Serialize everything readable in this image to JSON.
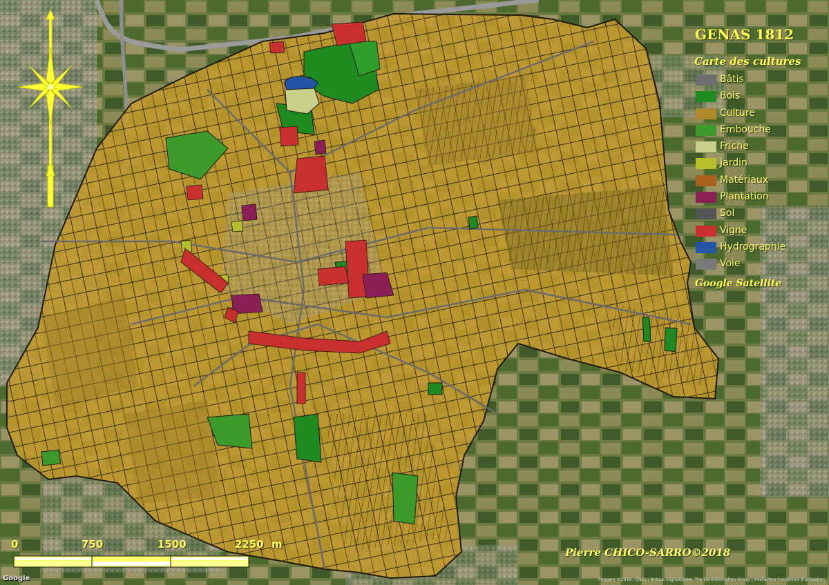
{
  "map": {
    "title": "GENAS 1812",
    "subtitle": "Carte des cultures",
    "source": "Google Satellite",
    "author": "Pierre CHICO-SARRO©2018",
    "google_logo": "Google",
    "attribution": "Imagery ©2018 , CNES / Airbus, DigitalGlobe, The GeoInformation Group | Interactive Conditions d'utilisation",
    "legend": [
      {
        "label": "Bâtis",
        "color": "#6e6e6e"
      },
      {
        "label": "Bois",
        "color": "#1f8a1f"
      },
      {
        "label": "Culture",
        "color": "#b08a2a"
      },
      {
        "label": "Embouche",
        "color": "#3c9a2a"
      },
      {
        "label": "Friche",
        "color": "#c8d08a"
      },
      {
        "label": "Jardin",
        "color": "#b7c02a"
      },
      {
        "label": "Matériaux",
        "color": "#a8621e"
      },
      {
        "label": "Plantation",
        "color": "#8a1f55"
      },
      {
        "label": "Sol",
        "color": "#555555"
      },
      {
        "label": "Vigne",
        "color": "#c83030"
      },
      {
        "label": "Hydrographie",
        "color": "#2456a8"
      },
      {
        "label": "Voie",
        "color": "#7a7a7a"
      }
    ],
    "scale": {
      "labels": [
        "0",
        "750",
        "1500",
        "2250"
      ],
      "unit": "m"
    }
  }
}
